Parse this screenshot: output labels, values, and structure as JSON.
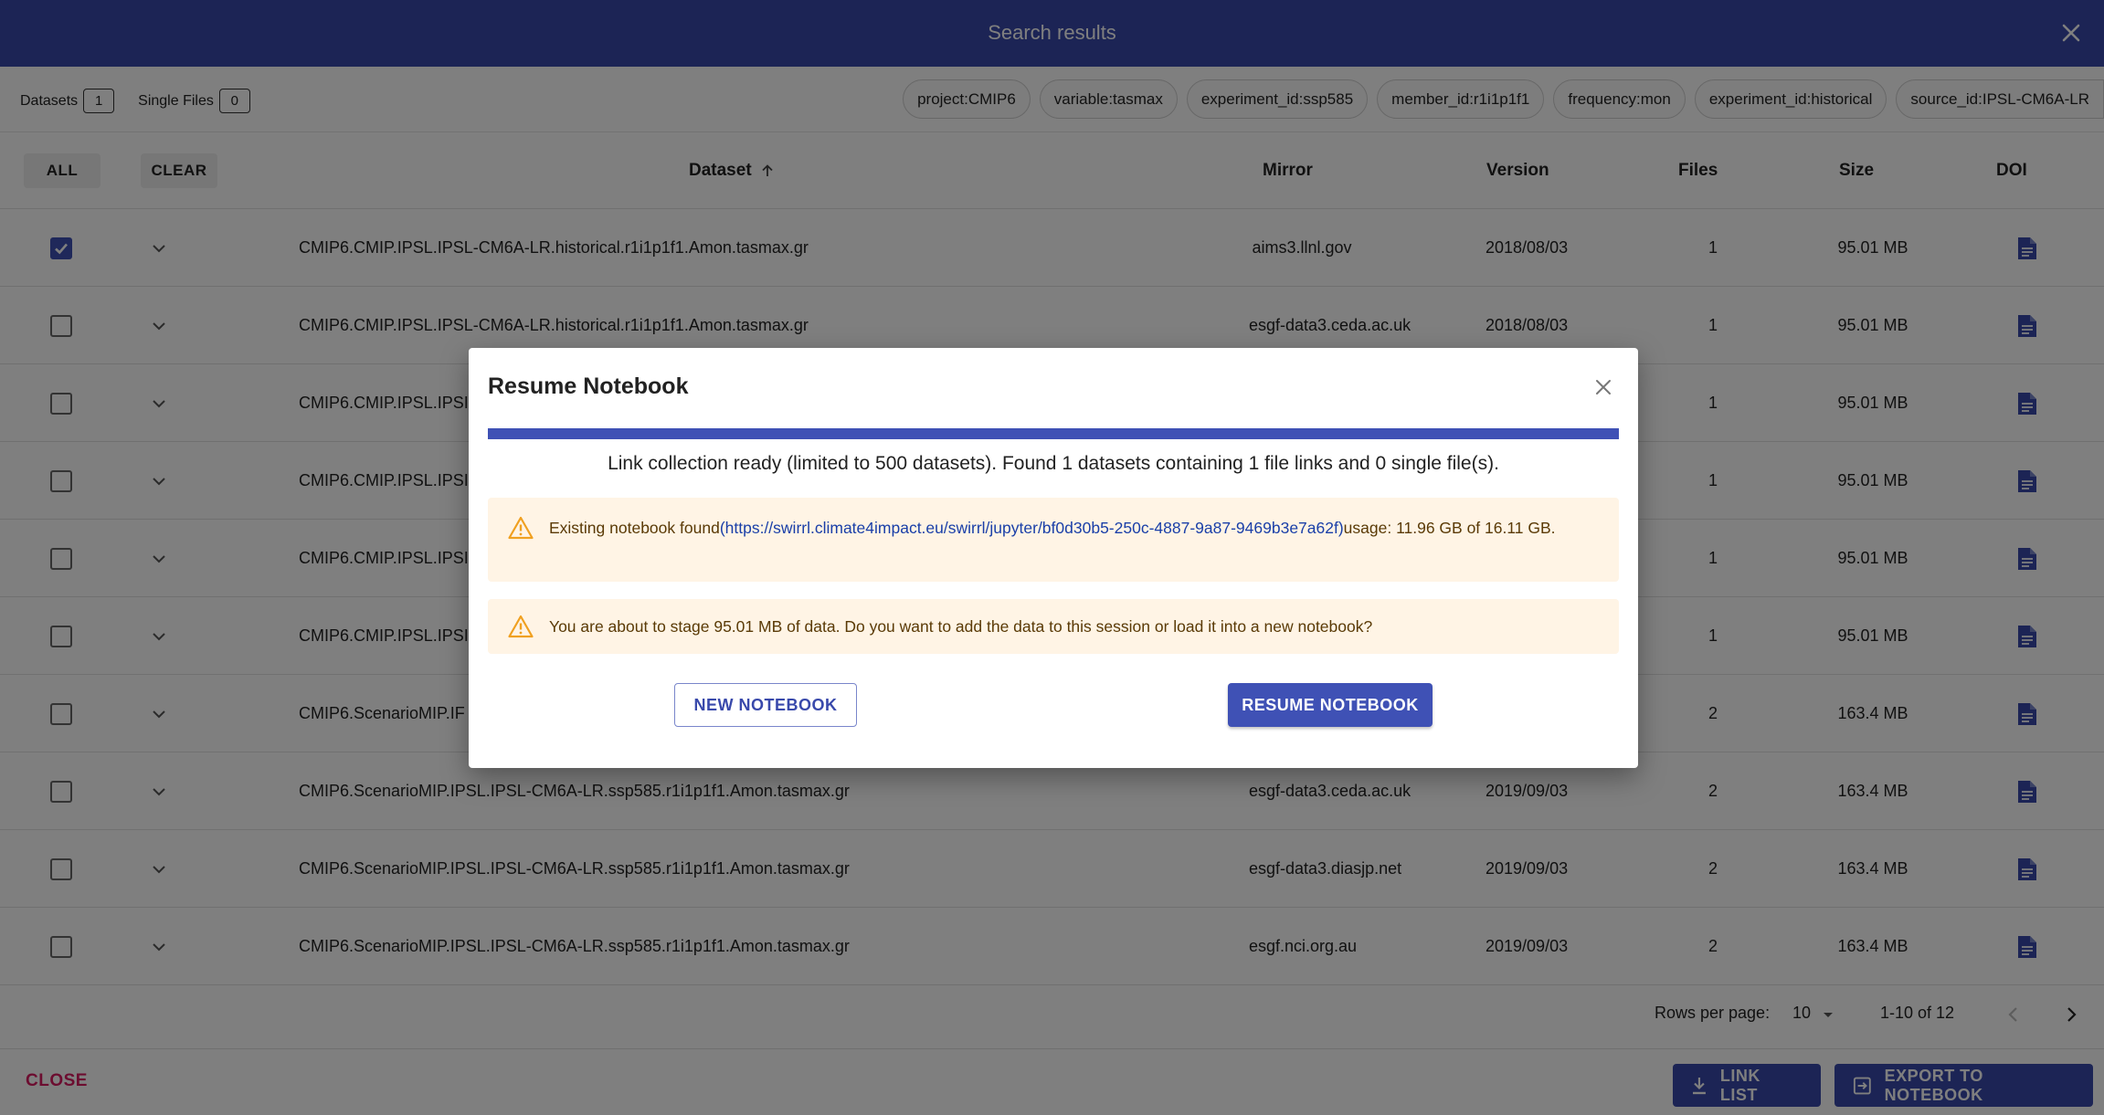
{
  "header": {
    "title": "Search results"
  },
  "counts": {
    "datasets_label": "Datasets",
    "datasets_count": "1",
    "files_label": "Single Files",
    "files_count": "0"
  },
  "filters": [
    "project:CMIP6",
    "variable:tasmax",
    "experiment_id:ssp585",
    "member_id:r1i1p1f1",
    "frequency:mon",
    "experiment_id:historical",
    "source_id:IPSL-CM6A-LR"
  ],
  "table": {
    "all_label": "ALL",
    "clear_label": "CLEAR",
    "columns": {
      "dataset": "Dataset",
      "mirror": "Mirror",
      "version": "Version",
      "files": "Files",
      "size": "Size",
      "doi": "DOI"
    },
    "rows": [
      {
        "checked": true,
        "dataset": "CMIP6.CMIP.IPSL.IPSL-CM6A-LR.historical.r1i1p1f1.Amon.tasmax.gr",
        "mirror": "aims3.llnl.gov",
        "version": "2018/08/03",
        "files": "1",
        "size": "95.01 MB"
      },
      {
        "checked": false,
        "dataset": "CMIP6.CMIP.IPSL.IPSL-CM6A-LR.historical.r1i1p1f1.Amon.tasmax.gr",
        "mirror": "esgf-data3.ceda.ac.uk",
        "version": "2018/08/03",
        "files": "1",
        "size": "95.01 MB"
      },
      {
        "checked": false,
        "dataset": "CMIP6.CMIP.IPSL.IPSI",
        "mirror": "",
        "version": "",
        "files": "1",
        "size": "95.01 MB"
      },
      {
        "checked": false,
        "dataset": "CMIP6.CMIP.IPSL.IPSI",
        "mirror": "",
        "version": "",
        "files": "1",
        "size": "95.01 MB"
      },
      {
        "checked": false,
        "dataset": "CMIP6.CMIP.IPSL.IPSI",
        "mirror": "",
        "version": "",
        "files": "1",
        "size": "95.01 MB"
      },
      {
        "checked": false,
        "dataset": "CMIP6.CMIP.IPSL.IPSI",
        "mirror": "",
        "version": "",
        "files": "1",
        "size": "95.01 MB"
      },
      {
        "checked": false,
        "dataset": "CMIP6.ScenarioMIP.IF",
        "mirror": "",
        "version": "",
        "files": "2",
        "size": "163.4 MB"
      },
      {
        "checked": false,
        "dataset": "CMIP6.ScenarioMIP.IPSL.IPSL-CM6A-LR.ssp585.r1i1p1f1.Amon.tasmax.gr",
        "mirror": "esgf-data3.ceda.ac.uk",
        "version": "2019/09/03",
        "files": "2",
        "size": "163.4 MB"
      },
      {
        "checked": false,
        "dataset": "CMIP6.ScenarioMIP.IPSL.IPSL-CM6A-LR.ssp585.r1i1p1f1.Amon.tasmax.gr",
        "mirror": "esgf-data3.diasjp.net",
        "version": "2019/09/03",
        "files": "2",
        "size": "163.4 MB"
      },
      {
        "checked": false,
        "dataset": "CMIP6.ScenarioMIP.IPSL.IPSL-CM6A-LR.ssp585.r1i1p1f1.Amon.tasmax.gr",
        "mirror": "esgf.nci.org.au",
        "version": "2019/09/03",
        "files": "2",
        "size": "163.4 MB"
      }
    ]
  },
  "pagination": {
    "rows_per_page_label": "Rows per page:",
    "rows_per_page": "10",
    "range": "1-10 of 12"
  },
  "footer": {
    "close_label": "CLOSE",
    "link_list_label": "LINK LIST",
    "export_label": "EXPORT TO NOTEBOOK"
  },
  "modal": {
    "title": "Resume Notebook",
    "progress": 1.0,
    "status": "Link collection ready (limited to 500 datasets). Found 1 datasets containing 1 file links and 0 single file(s).",
    "alert1_prefix": "Existing notebook found",
    "alert1_link": "(https://swirrl.climate4impact.eu/swirrl/jupyter/bf0d30b5-250c-4887-9a87-9469b3e7a62f)",
    "alert1_suffix": "usage: 11.96 GB of 16.11 GB.",
    "alert2": "You are about to stage 95.01 MB of data. Do you want to add the data to this session or load it into a new notebook?",
    "new_label": "NEW NOTEBOOK",
    "resume_label": "RESUME NOTEBOOK"
  },
  "colors": {
    "primary": "#3949ab",
    "accent_pink": "#d81b60",
    "warning_bg": "#fff4e5",
    "warning_icon": "#f0a020"
  },
  "icons": {
    "header_close": "close-icon",
    "sort": "arrow-up-icon",
    "expand": "chevron-down-icon",
    "doi": "document-icon",
    "download": "download-icon",
    "export": "export-icon",
    "warning": "warning-triangle-icon",
    "prev": "chevron-left-icon",
    "next": "chevron-right-icon"
  }
}
